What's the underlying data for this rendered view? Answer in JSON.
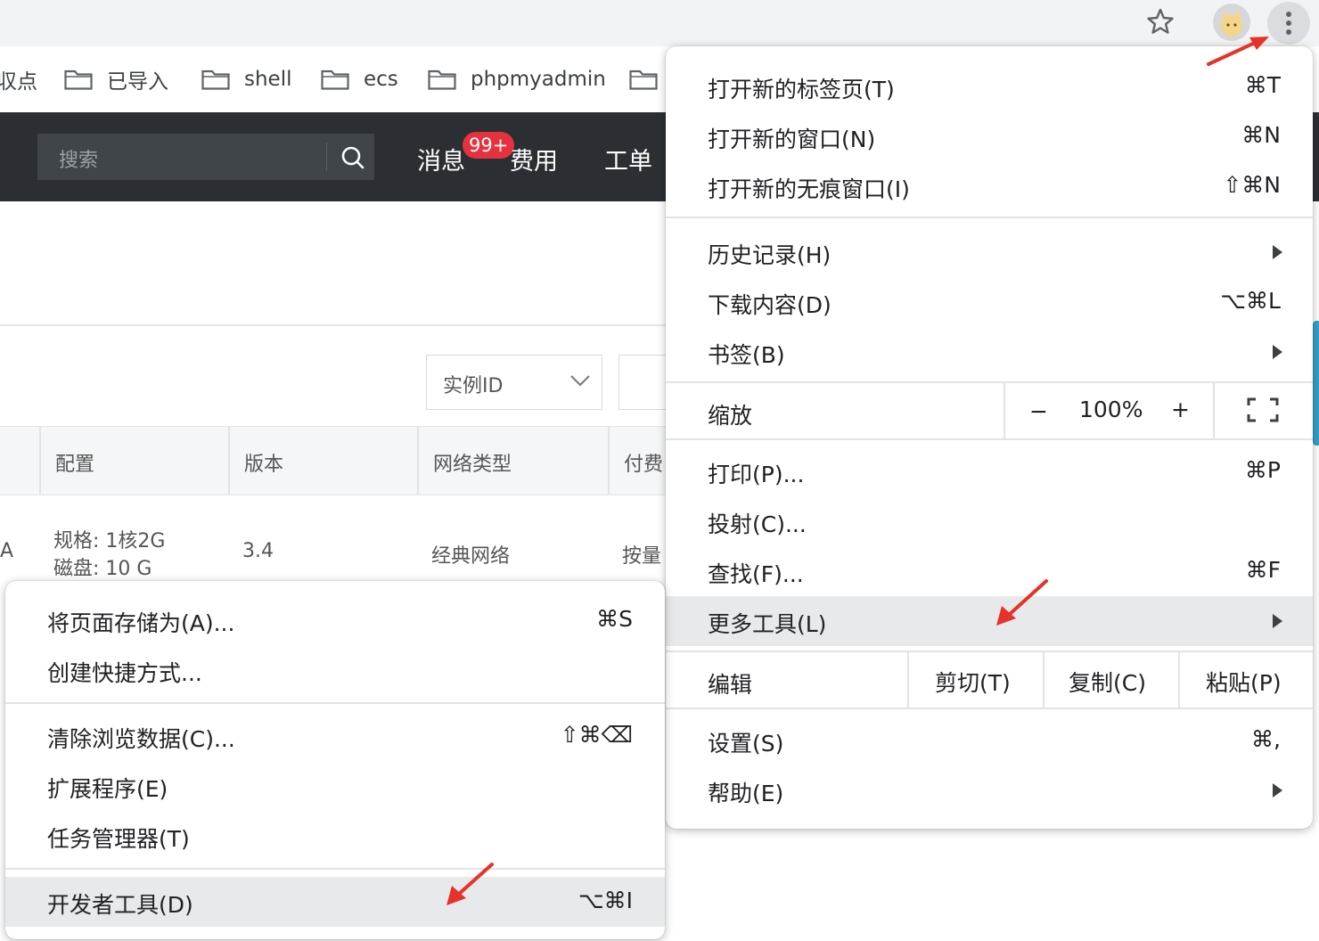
{
  "bookmarks": {
    "partial": "収点",
    "items": [
      "已导入",
      "shell",
      "ecs",
      "phpmyadmin"
    ]
  },
  "header": {
    "search_placeholder": "搜索",
    "nav": {
      "messages": "消息",
      "badge": "99+",
      "billing": "费用",
      "tickets": "工单"
    }
  },
  "filter": {
    "select_value": "实例ID"
  },
  "table": {
    "columns": [
      "配置",
      "版本",
      "网络类型",
      "付费"
    ],
    "row": {
      "lead": "A",
      "spec": "规格: 1核2G",
      "disk": "磁盘: 10 G",
      "version": "3.4",
      "network": "经典网络",
      "billing": "按量"
    }
  },
  "main_menu": {
    "new_tab": {
      "label": "打开新的标签页(T)",
      "shortcut": "⌘T"
    },
    "new_window": {
      "label": "打开新的窗口(N)",
      "shortcut": "⌘N"
    },
    "incognito": {
      "label": "打开新的无痕窗口(I)",
      "shortcut": "⇧⌘N"
    },
    "history": {
      "label": "历史记录(H)"
    },
    "downloads": {
      "label": "下载内容(D)",
      "shortcut": "⌥⌘L"
    },
    "bookmarks": {
      "label": "书签(B)"
    },
    "zoom": {
      "label": "缩放",
      "minus": "−",
      "value": "100%",
      "plus": "+"
    },
    "print": {
      "label": "打印(P)...",
      "shortcut": "⌘P"
    },
    "cast": {
      "label": "投射(C)..."
    },
    "find": {
      "label": "查找(F)...",
      "shortcut": "⌘F"
    },
    "more_tools": {
      "label": "更多工具(L)"
    },
    "edit": {
      "label": "编辑",
      "cut": "剪切(T)",
      "copy": "复制(C)",
      "paste": "粘贴(P)"
    },
    "settings": {
      "label": "设置(S)",
      "shortcut": "⌘,"
    },
    "help": {
      "label": "帮助(E)"
    }
  },
  "sub_menu": {
    "save_page": {
      "label": "将页面存储为(A)...",
      "shortcut": "⌘S"
    },
    "create_shortcut": {
      "label": "创建快捷方式..."
    },
    "clear_data": {
      "label": "清除浏览数据(C)...",
      "shortcut": "⇧⌘⌫"
    },
    "extensions": {
      "label": "扩展程序(E)"
    },
    "task_manager": {
      "label": "任务管理器(T)"
    },
    "devtools": {
      "label": "开发者工具(D)",
      "shortcut": "⌥⌘I"
    }
  },
  "colors": {
    "highlight": "#e8e9eb",
    "header_bg": "#2b2f33",
    "badge": "#e5323e",
    "annotation_arrow": "#e5332a"
  }
}
